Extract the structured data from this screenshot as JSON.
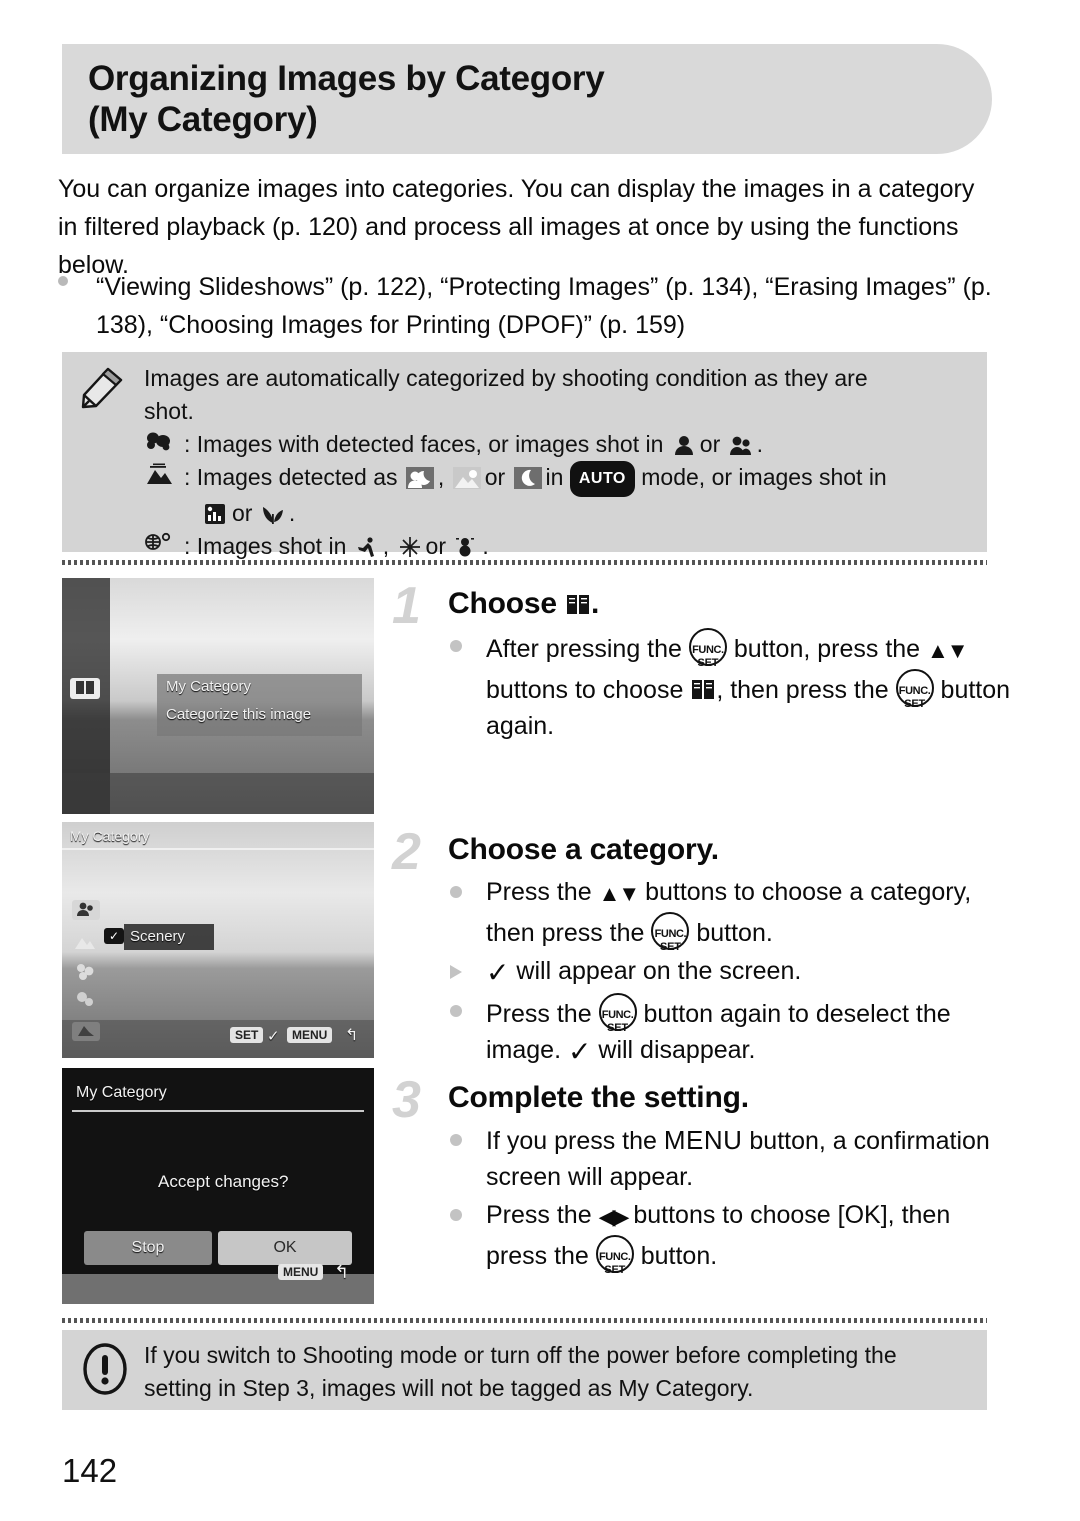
{
  "header": {
    "title_line1": "Organizing Images by Category",
    "title_line2": "(My Category)"
  },
  "intro": {
    "paragraph": "You can organize images into categories. You can display the images in a category in filtered playback (p. 120) and process all images at once by using the functions below.",
    "bullet": "“Viewing Slideshows” (p. 122), “Protecting Images” (p. 134), “Erasing Images” (p. 138), “Choosing Images for Printing (DPOF)” (p. 159)"
  },
  "note": {
    "icon": "pencil-icon",
    "line1": "Images are automatically categorized by shooting condition as they are",
    "line2": "shot.",
    "row1_key_icon": "people-category-icon",
    "row1_text_a": ": Images with detected faces, or images shot in",
    "row1_text_b": "or",
    "row1_text_c": ".",
    "row2_key_icon": "scenery-category-icon",
    "row2_text_a": ": Images detected as",
    "row2_text_b": ",",
    "row2_text_c": "or",
    "row2_text_d": "in",
    "row2_auto_badge": "AUTO",
    "row2_text_e": "mode, or images shot in",
    "row2_cont_text_a": "or",
    "row2_cont_text_b": ".",
    "row3_key_icon": "events-category-icon",
    "row3_text_a": ": Images shot in",
    "row3_text_b": ",",
    "row3_text_c": "or",
    "row3_text_d": "."
  },
  "steps": [
    {
      "number": "1",
      "title_prefix": "Choose",
      "title_icon": "my-category-book-icon",
      "title_suffix": ".",
      "bullets": [
        {
          "marker": "dot",
          "segments": [
            {
              "t": "text",
              "v": "After pressing the "
            },
            {
              "t": "icon",
              "v": "func-set-button-icon"
            },
            {
              "t": "text",
              "v": " button, press the "
            },
            {
              "t": "icon",
              "v": "up-down-buttons-icon"
            },
            {
              "t": "text",
              "v": " buttons to choose "
            },
            {
              "t": "icon",
              "v": "my-category-book-icon"
            },
            {
              "t": "text",
              "v": ", then press the "
            },
            {
              "t": "icon",
              "v": "func-set-button-icon"
            },
            {
              "t": "text",
              "v": " button again."
            }
          ]
        }
      ],
      "screen": {
        "name": "my-category-func-menu-screen",
        "title": "My Category",
        "subtitle": "Categorize this image"
      }
    },
    {
      "number": "2",
      "title_prefix": "Choose a category.",
      "title_icon": "",
      "title_suffix": "",
      "bullets": [
        {
          "marker": "dot",
          "segments": [
            {
              "t": "text",
              "v": "Press the "
            },
            {
              "t": "icon",
              "v": "up-down-buttons-icon"
            },
            {
              "t": "text",
              "v": " buttons to choose a category, then press the "
            },
            {
              "t": "icon",
              "v": "func-set-button-icon"
            },
            {
              "t": "text",
              "v": " button."
            }
          ]
        },
        {
          "marker": "triangle",
          "segments": [
            {
              "t": "icon",
              "v": "checkmark-icon"
            },
            {
              "t": "text",
              "v": " will appear on the screen."
            }
          ]
        },
        {
          "marker": "dot",
          "segments": [
            {
              "t": "text",
              "v": "Press the "
            },
            {
              "t": "icon",
              "v": "func-set-button-icon"
            },
            {
              "t": "text",
              "v": " button again to deselect the image. "
            },
            {
              "t": "icon",
              "v": "checkmark-icon"
            },
            {
              "t": "text",
              "v": " will disappear."
            }
          ]
        }
      ],
      "screen": {
        "name": "category-selection-screen",
        "title": "My Category",
        "selected_item": "Scenery",
        "footer_set": "SET",
        "footer_check": "✓",
        "footer_menu": "MENU"
      }
    },
    {
      "number": "3",
      "title_prefix": "Complete the setting.",
      "title_icon": "",
      "title_suffix": "",
      "bullets": [
        {
          "marker": "dot",
          "segments": [
            {
              "t": "text",
              "v": "If you press the "
            },
            {
              "t": "word",
              "v": "MENU"
            },
            {
              "t": "text",
              "v": " button, a confirmation screen will appear."
            }
          ]
        },
        {
          "marker": "dot",
          "segments": [
            {
              "t": "text",
              "v": "Press the "
            },
            {
              "t": "icon",
              "v": "left-right-buttons-icon"
            },
            {
              "t": "text",
              "v": " buttons to choose [OK], then press the "
            },
            {
              "t": "icon",
              "v": "func-set-button-icon"
            },
            {
              "t": "text",
              "v": " button."
            }
          ]
        }
      ],
      "screen": {
        "name": "accept-changes-confirmation-screen",
        "title": "My Category",
        "prompt": "Accept changes?",
        "button_stop": "Stop",
        "button_ok": "OK",
        "footer_menu": "MENU"
      }
    }
  ],
  "warning": {
    "icon": "exclamation-icon",
    "line1": "If you switch to Shooting mode or turn off the power before completing the",
    "line2": "setting in Step 3, images will not be tagged as My Category."
  },
  "footer": {
    "page_number": "142"
  },
  "colors": {
    "banner_bg": "#d9d9d9",
    "note_bg": "#d4d4d4",
    "step_number": "#d2d2d2",
    "bullet_marker": "#c3c3c3",
    "text": "#111111"
  }
}
